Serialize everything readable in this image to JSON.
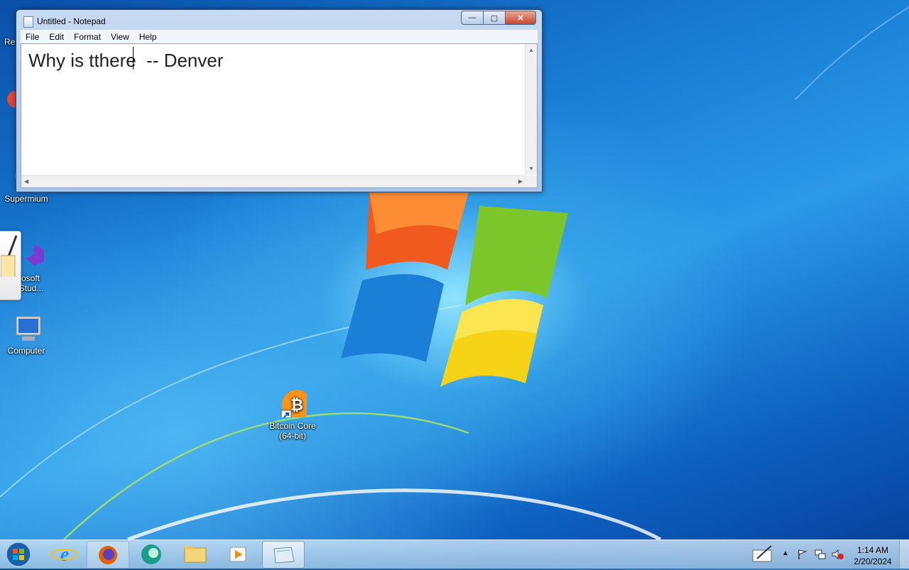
{
  "notepad": {
    "title": "Untitled - Notepad",
    "menu": [
      "File",
      "Edit",
      "Format",
      "View",
      "Help"
    ],
    "content": "Why is tthere  -- Denver",
    "buttons": {
      "minimize": "—",
      "maximize": "▢",
      "close": "✕"
    }
  },
  "desktop_icons": {
    "recycle_bin": "Re",
    "supermium": "Supermium",
    "visual_studio": "rosoft\nl Stud...",
    "computer": "Computer",
    "bitcoin": "Bitcoin Core\n(64-bit)"
  },
  "taskbar": {
    "pinned": [
      "start",
      "internet-explorer",
      "firefox",
      "edge",
      "file-explorer",
      "media-player",
      "notepad"
    ],
    "clock_time": "1:14 AM",
    "clock_date": "2/20/2024"
  },
  "colors": {
    "accent": "#1a7fd6",
    "window_frame": "#a9c4e6",
    "close_red": "#c7452c"
  }
}
